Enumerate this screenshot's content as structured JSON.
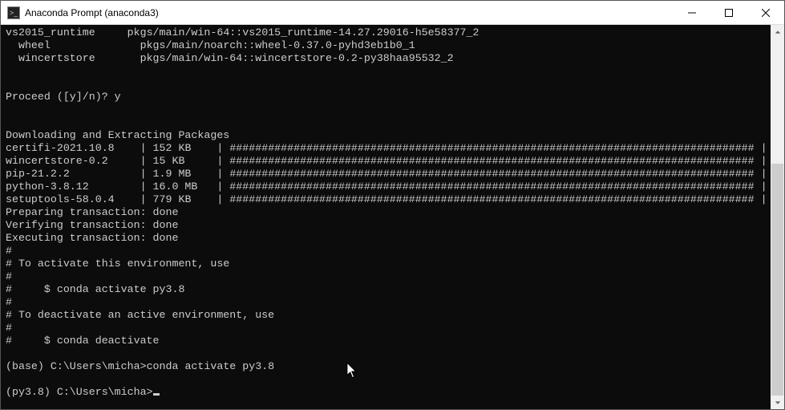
{
  "window": {
    "title": "Anaconda Prompt (anaconda3)"
  },
  "pkgs": [
    {
      "name": "vs2015_runtime",
      "spec": "pkgs/main/win-64::vs2015_runtime-14.27.29016-h5e58377_2"
    },
    {
      "name": "wheel",
      "spec": "pkgs/main/noarch::wheel-0.37.0-pyhd3eb1b0_1"
    },
    {
      "name": "wincertstore",
      "spec": "pkgs/main/win-64::wincertstore-0.2-py38haa95532_2"
    }
  ],
  "proceed": {
    "prompt": "Proceed ([y]/n)? ",
    "answer": "y"
  },
  "download_header": "Downloading and Extracting Packages",
  "downloads": [
    {
      "name": "certifi-2021.10.8",
      "size": "152 KB",
      "bar": "##################################################################################",
      "pct": "100%"
    },
    {
      "name": "wincertstore-0.2",
      "size": "15 KB",
      "bar": "##################################################################################",
      "pct": "100%"
    },
    {
      "name": "pip-21.2.2",
      "size": "1.9 MB",
      "bar": "##################################################################################",
      "pct": "100%"
    },
    {
      "name": "python-3.8.12",
      "size": "16.0 MB",
      "bar": "##################################################################################",
      "pct": "100%"
    },
    {
      "name": "setuptools-58.0.4",
      "size": "779 KB",
      "bar": "##################################################################################",
      "pct": "100%"
    }
  ],
  "trans": {
    "prep": "Preparing transaction: done",
    "verify": "Verifying transaction: done",
    "exec": "Executing transaction: done"
  },
  "help": {
    "l0": "#",
    "l1": "# To activate this environment, use",
    "l2": "#",
    "l3": "#     $ conda activate py3.8",
    "l4": "#",
    "l5": "# To deactivate an active environment, use",
    "l6": "#",
    "l7": "#     $ conda deactivate"
  },
  "prompt1": {
    "prefix": "(base) C:\\Users\\micha>",
    "cmd": "conda activate py3.8"
  },
  "prompt2": {
    "prefix": "(py3.8) C:\\Users\\micha>"
  }
}
